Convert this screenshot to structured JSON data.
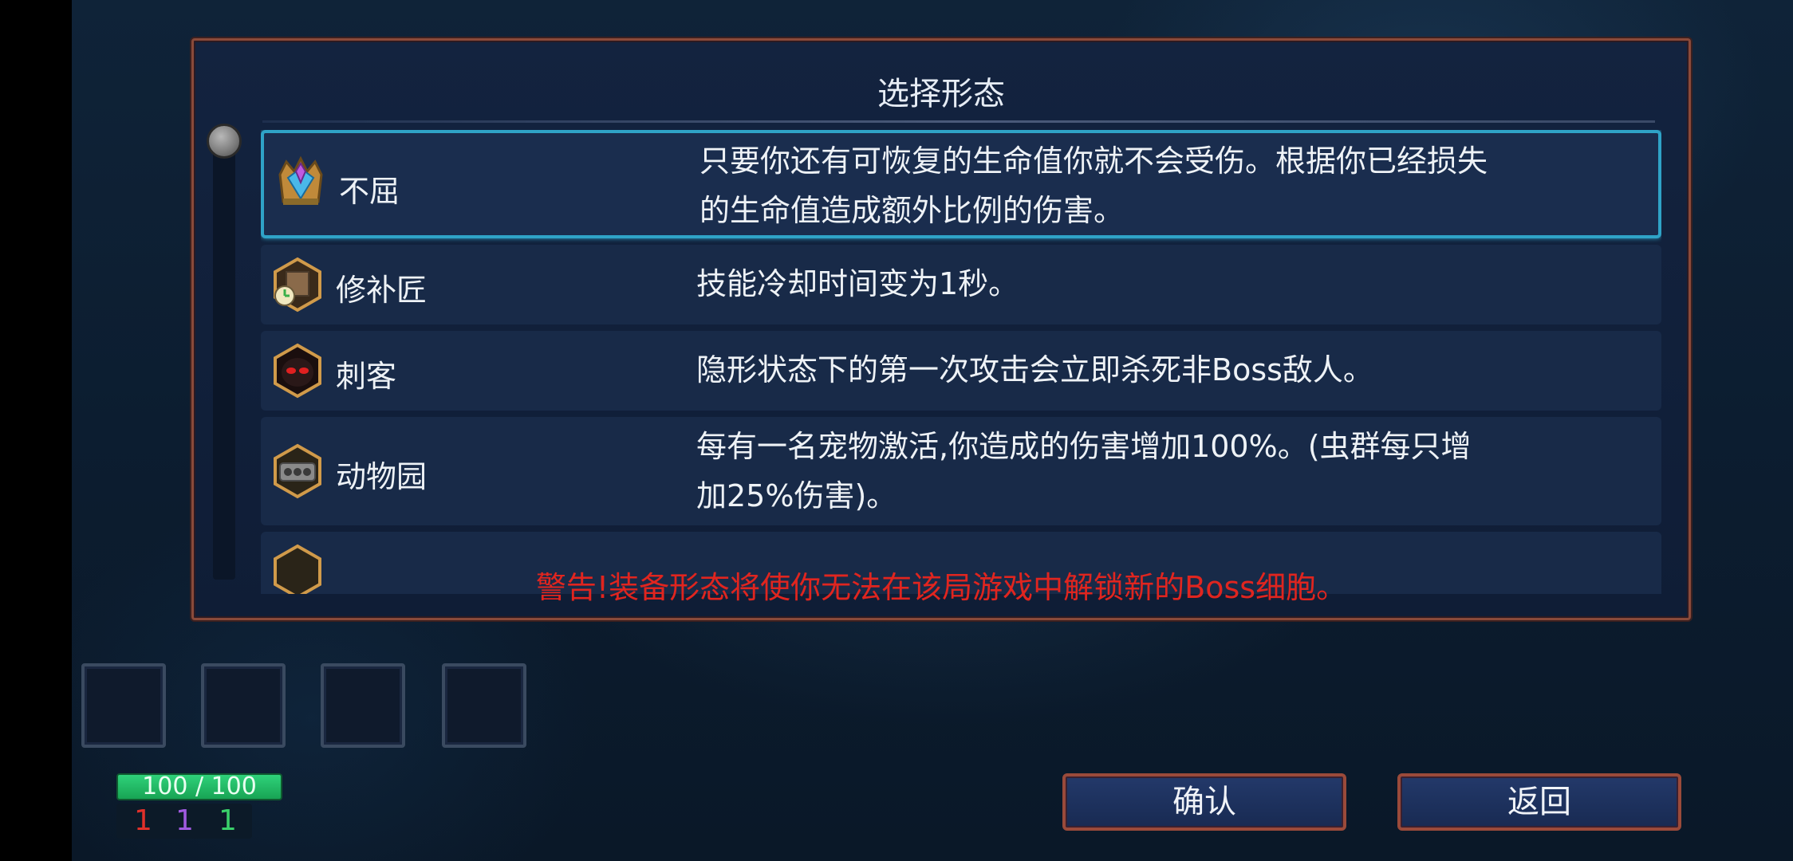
{
  "dialog": {
    "title": "选择形态",
    "warning": "警告!装备形态将使你无法在该局游戏中解锁新的Boss细胞。",
    "items": [
      {
        "icon": "crown-gem-icon",
        "name": "不屈",
        "desc_lines": [
          "只要你还有可恢复的生命值你就不会受伤。根据你已经损失",
          "的生命值造成额外比例的伤害。"
        ],
        "selected": true
      },
      {
        "icon": "tinker-clock-icon",
        "name": "修补匠",
        "desc_lines": [
          "技能冷却时间变为1秒。"
        ],
        "selected": false
      },
      {
        "icon": "assassin-mask-icon",
        "name": "刺客",
        "desc_lines": [
          "隐形状态下的第一次攻击会立即杀死非Boss敌人。"
        ],
        "selected": false
      },
      {
        "icon": "zoo-cage-icon",
        "name": "动物园",
        "desc_lines": [
          "每有一名宠物激活,你造成的伤害增加100%。(虫群每只增",
          "加25%伤害)。"
        ],
        "selected": false
      }
    ]
  },
  "hud": {
    "hp_text": "100 / 100",
    "hp_fraction": 1.0,
    "counters": [
      {
        "value": "1",
        "color": "#e0302a"
      },
      {
        "value": "1",
        "color": "#a05ae0"
      },
      {
        "value": "1",
        "color": "#3ad06a"
      }
    ]
  },
  "buttons": {
    "confirm": "确认",
    "back": "返回"
  },
  "colors": {
    "frame": "#8a4a3a",
    "selection": "#2fa3c7",
    "warning": "#e0251f"
  }
}
